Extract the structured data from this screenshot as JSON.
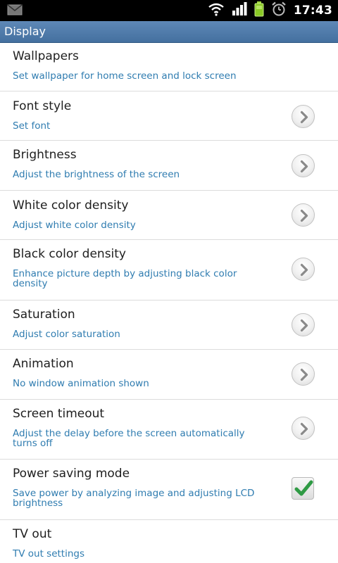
{
  "status_bar": {
    "notification_icon": "mail-icon",
    "wifi_icon": "wifi-icon",
    "signal_icon": "signal-bars-icon",
    "battery_icon": "battery-icon",
    "alarm_icon": "alarm-clock-icon",
    "time": "17:43"
  },
  "header": {
    "title": "Display"
  },
  "settings": {
    "items": [
      {
        "title": "Wallpapers",
        "subtitle": "Set wallpaper for home screen and lock screen",
        "control": "none"
      },
      {
        "title": "Font style",
        "subtitle": "Set font",
        "control": "chevron-right-icon"
      },
      {
        "title": "Brightness",
        "subtitle": "Adjust the brightness of the screen",
        "control": "chevron-right-icon"
      },
      {
        "title": "White color density",
        "subtitle": "Adjust white color density",
        "control": "chevron-right-icon"
      },
      {
        "title": "Black color density",
        "subtitle": "Enhance picture depth by adjusting black color density",
        "control": "chevron-right-icon"
      },
      {
        "title": "Saturation",
        "subtitle": "Adjust color saturation",
        "control": "chevron-right-icon"
      },
      {
        "title": "Animation",
        "subtitle": "No window animation shown",
        "control": "chevron-right-icon"
      },
      {
        "title": "Screen timeout",
        "subtitle": "Adjust the delay before the screen automatically turns off",
        "control": "chevron-right-icon"
      },
      {
        "title": "Power saving mode",
        "subtitle": "Save power by analyzing image and adjusting LCD brightness",
        "control": "checkbox",
        "checked": true
      },
      {
        "title": "TV out",
        "subtitle": "TV out settings",
        "control": "none"
      }
    ]
  },
  "colors": {
    "subtitle": "#2f7cb0",
    "titlebar": "#4f7aa9",
    "check": "#2f9a44"
  }
}
